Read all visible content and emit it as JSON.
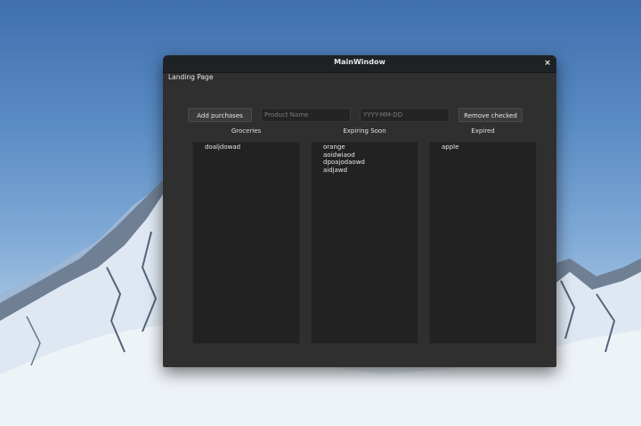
{
  "window": {
    "title": "MainWindow",
    "close_glyph": "×"
  },
  "page": {
    "label": "Landing Page"
  },
  "toolbar": {
    "add_label": "Add purchases",
    "product_placeholder": "Product Name",
    "date_placeholder": "YYYY-MM-DD",
    "remove_label": "Remove checked"
  },
  "columns": {
    "groceries": {
      "header": "Groceries",
      "items": [
        "doaljdowad"
      ]
    },
    "expiring": {
      "header": "Expiring Soon",
      "items": [
        "orange",
        "aoidwiaod",
        "dpoajodaowd",
        "aidjawd"
      ]
    },
    "expired": {
      "header": "Expired",
      "items": [
        "apple"
      ]
    }
  },
  "colors": {
    "titlebar": "#1f2224",
    "window_bg": "#2f2f2f",
    "list_bg": "#222222",
    "button_bg": "#3b3b3b"
  }
}
